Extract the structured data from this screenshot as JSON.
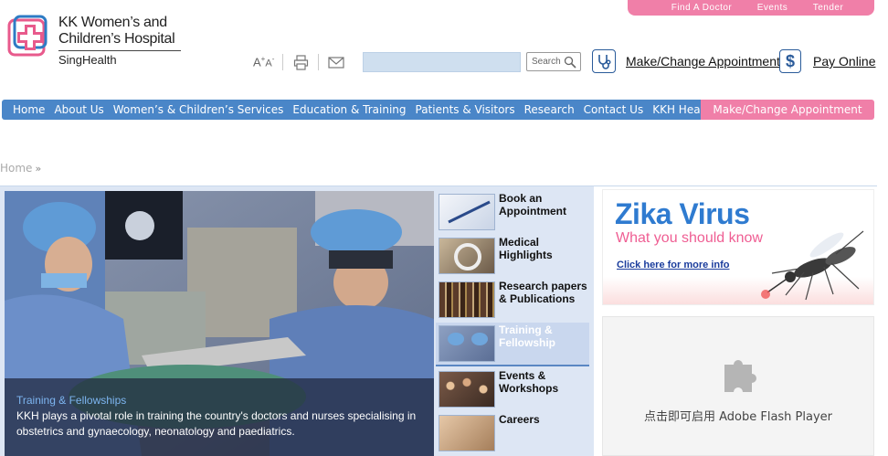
{
  "util_bar": {
    "items": [
      "Find A Doctor",
      "Events",
      "Tender"
    ]
  },
  "logo": {
    "line1": "KK Women’s and",
    "line2": "Children’s Hospital",
    "line3": "SingHealth"
  },
  "tools": {
    "font_large": "A",
    "font_small": "A",
    "font_sup": "+",
    "font_sup_minus": "-"
  },
  "search": {
    "placeholder": "",
    "button_label": "Search"
  },
  "header_links": {
    "appointment": "Make/Change Appointment",
    "pay": "Pay Online"
  },
  "nav": {
    "items": [
      "Home",
      "About Us",
      "Women’s & Children’s Services",
      "Education & Training",
      "Patients & Visitors",
      "Research",
      "Contact Us",
      "KKH HealthPedia"
    ],
    "highlight": "Make/Change Appointment"
  },
  "breadcrumb": {
    "home": "Home",
    "sep": "»"
  },
  "hero": {
    "title": "Training & Fellowships",
    "description": "KKH plays a pivotal role in training the country's doctors and nurses specialising in obstetrics and gynaecology, neonatology and paediatrics."
  },
  "side_items": [
    {
      "label": "Book an Appointment"
    },
    {
      "label": "Medical Highlights"
    },
    {
      "label": "Research papers & Publications"
    },
    {
      "label": "Training & Fellowship"
    },
    {
      "label": "Events & Workshops"
    },
    {
      "label": "Careers"
    }
  ],
  "zika": {
    "title": "Zika Virus",
    "subtitle": "What you should know",
    "link": "Click here for more info"
  },
  "flash": {
    "text": "点击即可启用 Adobe Flash Player"
  },
  "colors": {
    "nav_blue": "#4a86c8",
    "accent_pink": "#f07fa8",
    "zika_blue": "#2f7bd0",
    "zika_pink": "#ef5e93"
  }
}
